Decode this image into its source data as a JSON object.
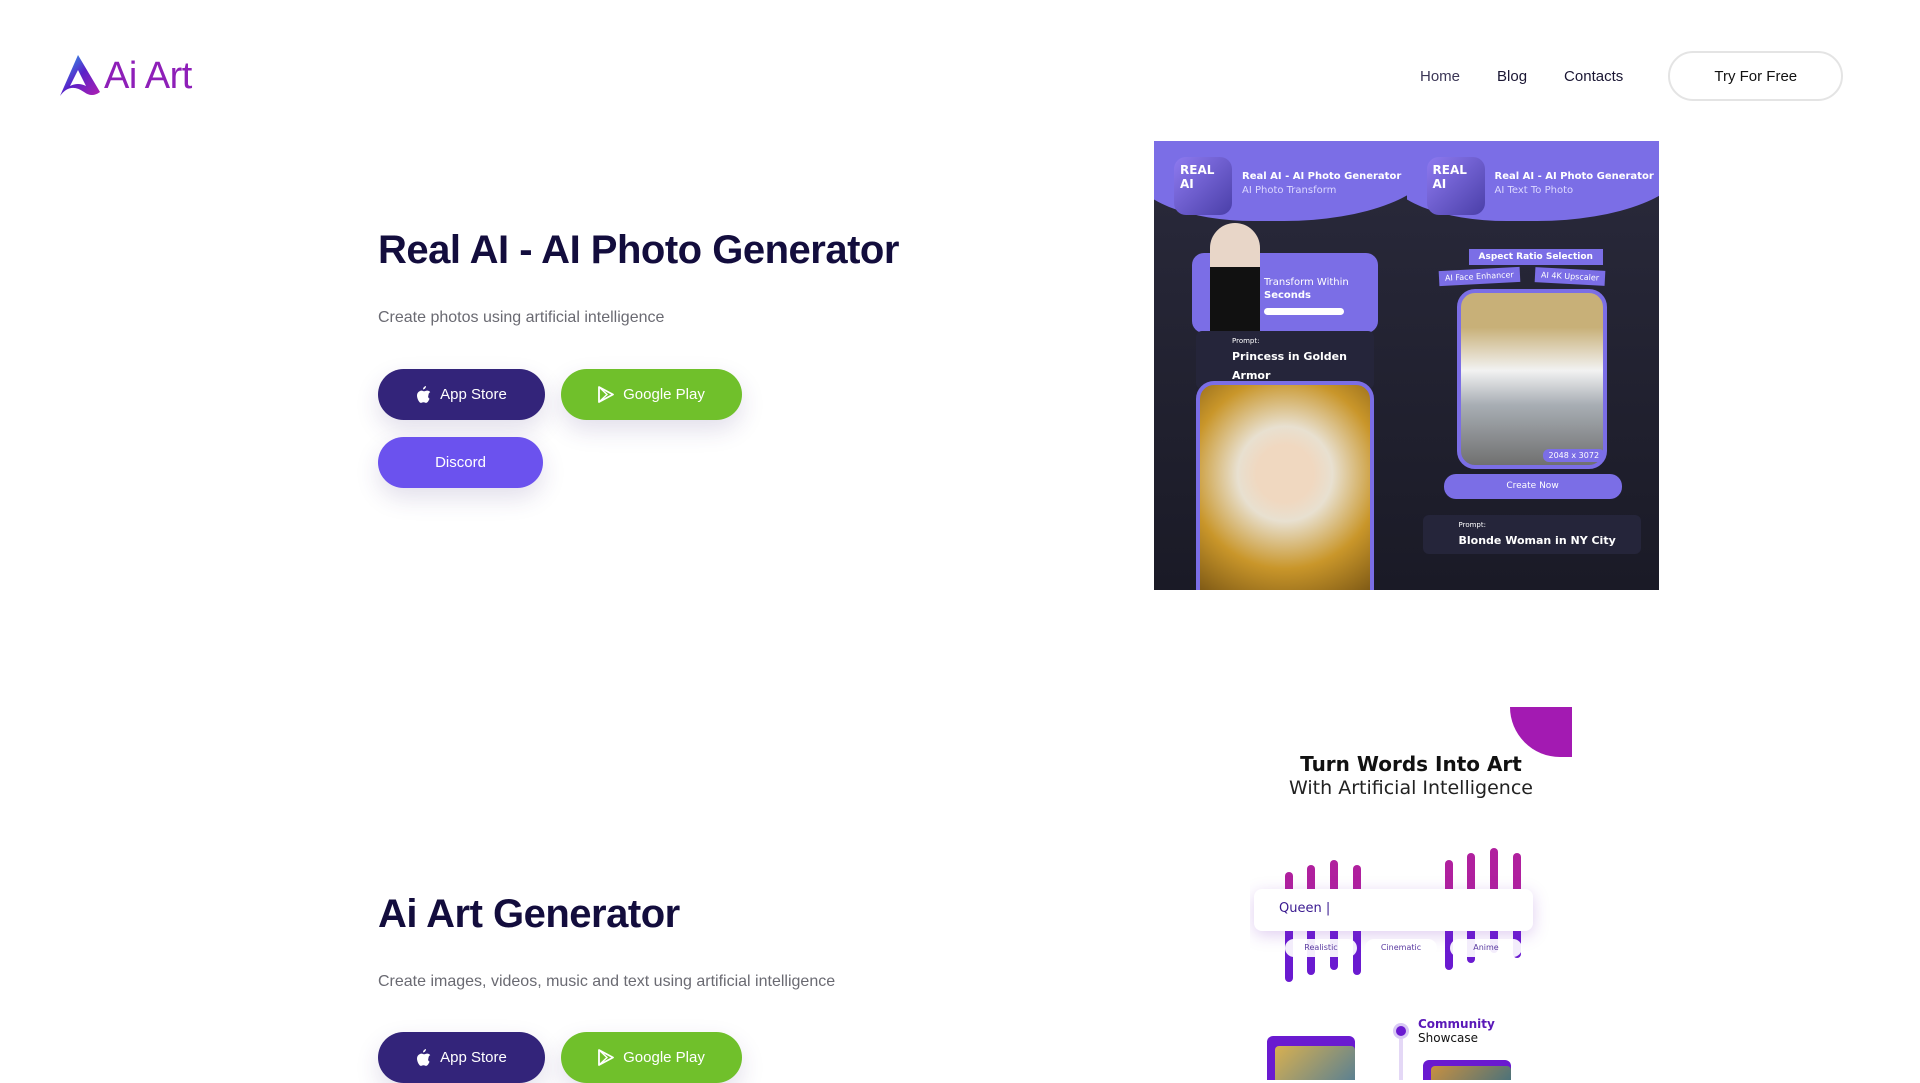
{
  "header": {
    "logo_text": "Ai Art",
    "nav": [
      "Home",
      "Blog",
      "Contacts"
    ],
    "cta": "Try For Free"
  },
  "sections": [
    {
      "title": "Real AI - AI Photo Generator",
      "subtitle": "Create photos using artificial intelligence",
      "buttons": {
        "app_store": "App Store",
        "google_play": "Google Play",
        "discord": "Discord"
      },
      "promo": {
        "app_icon": "REAL AI",
        "left": {
          "title": "Real AI - AI Photo Generator",
          "subtitle": "AI Photo Transform",
          "card_line1": "Transform Within",
          "card_line2": "Seconds",
          "prompt_label": "Prompt:",
          "prompt": "Princess in Golden Armor"
        },
        "right": {
          "title": "Real AI - AI Photo Generator",
          "subtitle": "AI Text To Photo",
          "tag_aspect": "Aspect Ratio Selection",
          "tag_face": "AI Face Enhancer",
          "tag_upscale": "AI 4K Upscaler",
          "resolution": "2048 x 3072",
          "create": "Create Now",
          "prompt_label": "Prompt:",
          "prompt": "Blonde Woman in NY City"
        }
      }
    },
    {
      "title": "Ai Art Generator",
      "subtitle": "Create images, videos, music and text using artificial intelligence",
      "buttons": {
        "app_store": "App Store",
        "google_play": "Google Play"
      },
      "promo": {
        "line1": "Turn Words Into Art",
        "line2": "With Artificial Intelligence",
        "input": "Queen |",
        "chips": [
          "Realistic",
          "Cinematic",
          "Anime"
        ],
        "community1": "Community",
        "community2": "Showcase"
      }
    }
  ],
  "colors": {
    "apple": "#33247a",
    "google": "#70c02b",
    "discord": "#6b52ee",
    "heading": "#130d3d"
  }
}
